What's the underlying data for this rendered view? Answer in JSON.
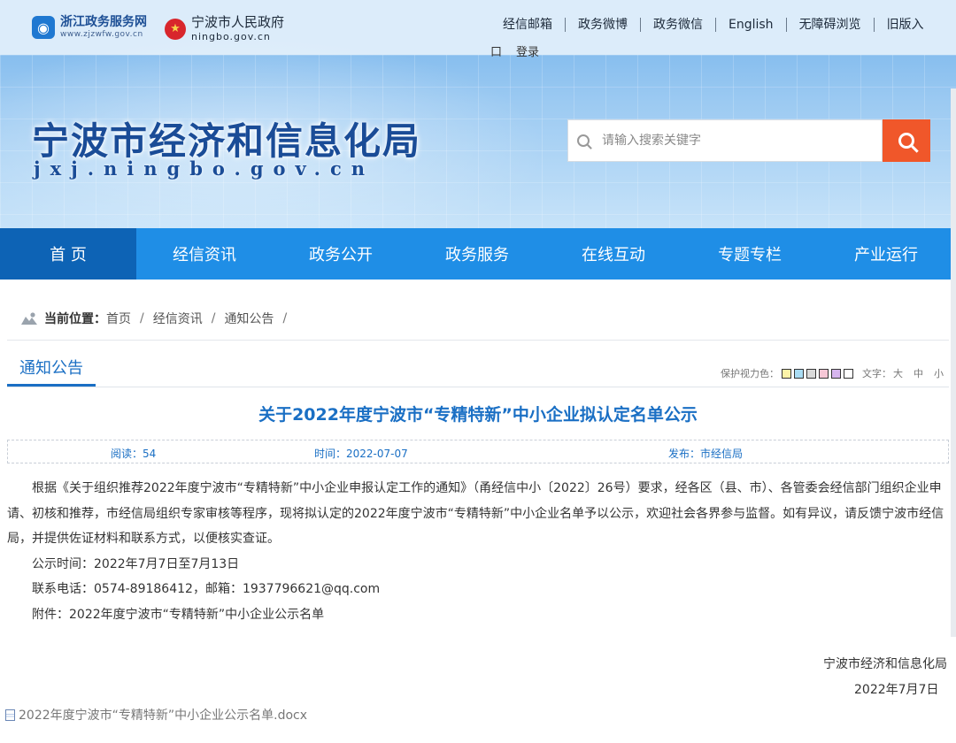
{
  "header": {
    "logo1": {
      "cn": "浙江政务服务网",
      "en": "www.zjzwfw.gov.cn"
    },
    "logo2": {
      "cn": "宁波市人民政府",
      "en": "ningbo.gov.cn"
    },
    "top_links": [
      "经信邮箱",
      "政务微博",
      "政务微信",
      "English",
      "无障碍浏览",
      "旧版入"
    ],
    "top_links_row2": [
      "口",
      "登录"
    ],
    "site_title": "宁波市经济和信息化局",
    "site_domain": "jxj.ningbo.gov.cn",
    "search_placeholder": "请输入搜索关键字"
  },
  "nav": [
    "首 页",
    "经信资讯",
    "政务公开",
    "政务服务",
    "在线互动",
    "专题专栏",
    "产业运行"
  ],
  "breadcrumb": {
    "label": "当前位置：",
    "items": [
      "首页",
      "经信资讯",
      "通知公告"
    ],
    "sep": "/"
  },
  "section": {
    "title": "通知公告"
  },
  "tools": {
    "protect_label": "保护视力色：",
    "swatches": [
      "#fdf3a8",
      "#a9dcf3",
      "#d9d9d9",
      "#f6c7d6",
      "#d6b5ee",
      "#ffffff"
    ],
    "font_label": "文字：",
    "sizes": [
      "大",
      "中",
      "小"
    ]
  },
  "article": {
    "title": "关于2022年度宁波市“专精特新”中小企业拟认定名单公示",
    "reads": "阅读：54",
    "time": "时间：2022-07-07",
    "publisher": "发布：市经信局",
    "paragraphs": [
      "根据《关于组织推荐2022年度宁波市“专精特新”中小企业申报认定工作的通知》（甬经信中小〔2022〕26号）要求，经各区（县、市）、各管委会经信部门组织企业申请、初核和推荐，市经信局组织专家审核等程序，现将拟认定的2022年度宁波市“专精特新”中小企业名单予以公示，欢迎社会各界参与监督。如有异议，请反馈宁波市经信局，并提供佐证材料和联系方式，以便核实查证。",
      "公示时间：2022年7月7日至7月13日",
      "联系电话：0574-89186412，邮箱：1937796621@qq.com",
      "附件：2022年度宁波市“专精特新”中小企业公示名单"
    ],
    "signature": "宁波市经济和信息化局",
    "date": "2022年7月7日",
    "attachment": "2022年度宁波市“专精特新”中小企业公示名单.docx"
  }
}
